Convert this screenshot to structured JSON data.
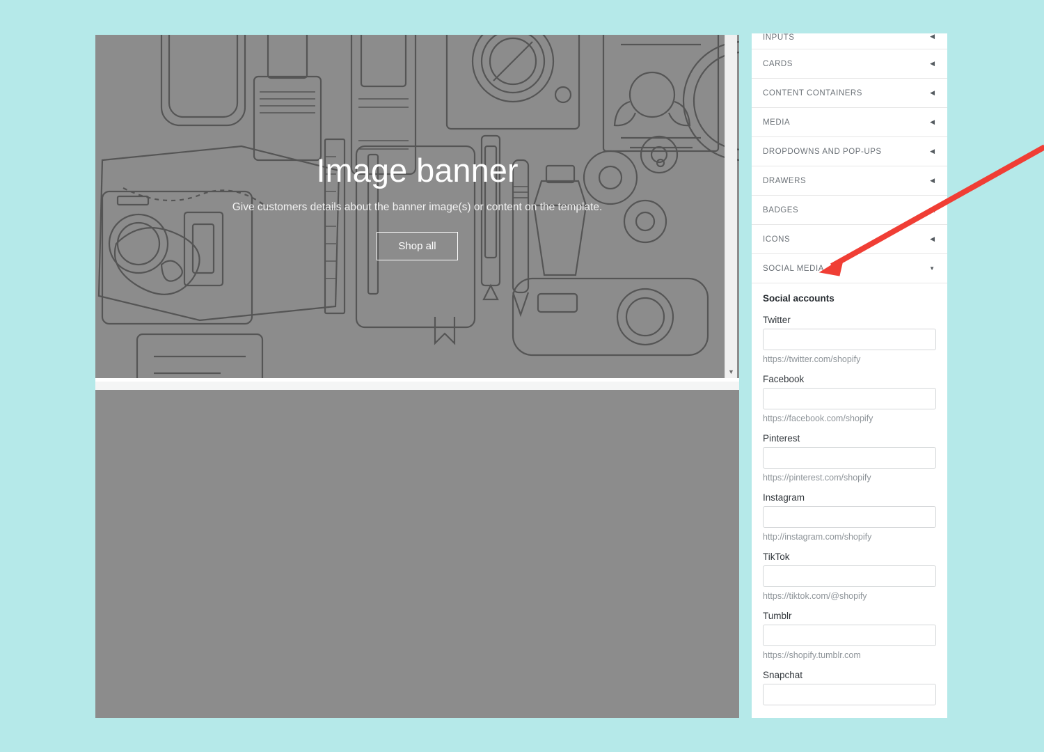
{
  "colors": {
    "page_background": "#b5e9e9",
    "preview_placeholder": "#8c8c8c",
    "panel_background": "#ffffff",
    "annotation_arrow": "#f03e35",
    "section_label": "#6b7177",
    "help_text": "#8e9499",
    "input_border": "#d3d6d8"
  },
  "preview": {
    "banner": {
      "heading": "Image banner",
      "subheading": "Give customers details about the banner image(s) or content on the template.",
      "cta_label": "Shop all"
    },
    "scrollbar": {
      "down_arrow_icon": "▼"
    }
  },
  "sidebar": {
    "sections": [
      {
        "label": "INPUTS",
        "caret_icon": "◀",
        "expanded": false
      },
      {
        "label": "CARDS",
        "caret_icon": "◀",
        "expanded": false
      },
      {
        "label": "CONTENT CONTAINERS",
        "caret_icon": "◀",
        "expanded": false
      },
      {
        "label": "MEDIA",
        "caret_icon": "◀",
        "expanded": false
      },
      {
        "label": "DROPDOWNS AND POP-UPS",
        "caret_icon": "◀",
        "expanded": false
      },
      {
        "label": "DRAWERS",
        "caret_icon": "◀",
        "expanded": false
      },
      {
        "label": "BADGES",
        "caret_icon": "◀",
        "expanded": false
      },
      {
        "label": "ICONS",
        "caret_icon": "◀",
        "expanded": false
      },
      {
        "label": "SOCIAL MEDIA",
        "caret_icon": "▼",
        "expanded": true
      }
    ],
    "social_media": {
      "title": "Social accounts",
      "fields": [
        {
          "label": "Twitter",
          "value": "",
          "help": "https://twitter.com/shopify"
        },
        {
          "label": "Facebook",
          "value": "",
          "help": "https://facebook.com/shopify"
        },
        {
          "label": "Pinterest",
          "value": "",
          "help": "https://pinterest.com/shopify"
        },
        {
          "label": "Instagram",
          "value": "",
          "help": "http://instagram.com/shopify"
        },
        {
          "label": "TikTok",
          "value": "",
          "help": "https://tiktok.com/@shopify"
        },
        {
          "label": "Tumblr",
          "value": "",
          "help": "https://shopify.tumblr.com"
        },
        {
          "label": "Snapchat",
          "value": "",
          "help": ""
        }
      ]
    }
  }
}
